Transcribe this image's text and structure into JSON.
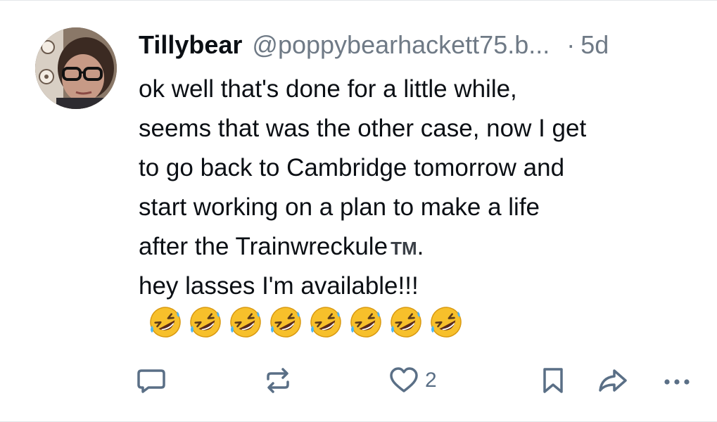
{
  "post": {
    "display_name": "Tillybear",
    "handle": "@poppybearhackett75.b...",
    "separator": "·",
    "time": "5d",
    "lines": [
      "ok well that's done for a little while,",
      "seems that was the other case, now I get",
      "to go back to Cambridge tomorrow and",
      "start working on a plan to make a life",
      "after the Trainwreckule",
      "hey lasses I'm available!!!"
    ],
    "trademark": "TM",
    "line5_end": ".",
    "emoji_name": "rolling-on-the-floor-laughing",
    "emoji_count": 8
  },
  "actions": {
    "reply_icon": "speech-bubble-icon",
    "repost_icon": "repost-arrows-icon",
    "like_icon": "heart-icon",
    "like_count": "2",
    "bookmark_icon": "bookmark-icon",
    "share_icon": "share-arrow-icon",
    "more_icon": "ellipsis-icon"
  },
  "colors": {
    "text": "#0b0f14",
    "muted": "#6f7a86",
    "action": "#5a6f86",
    "divider": "#e3e6ea"
  }
}
